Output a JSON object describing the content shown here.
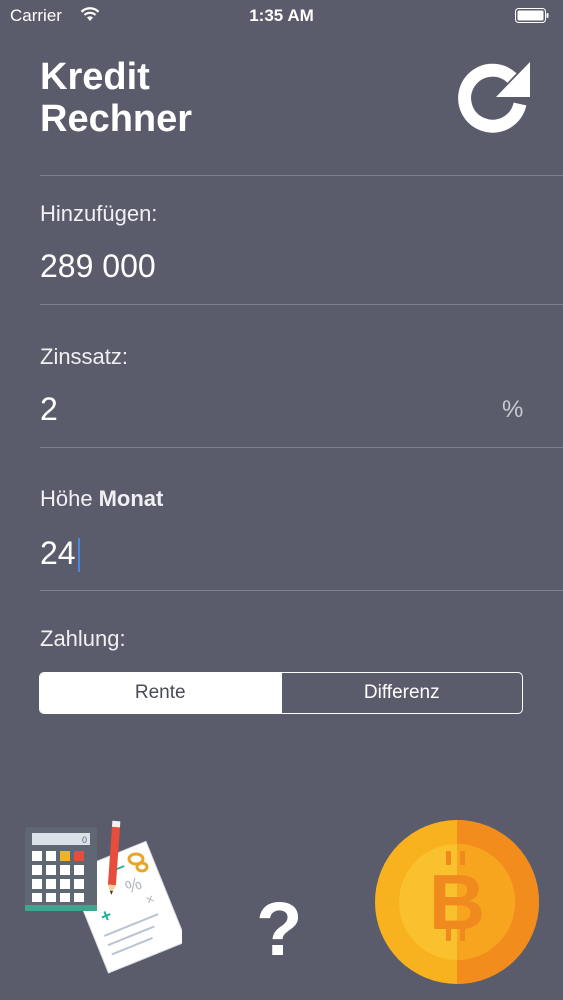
{
  "status_bar": {
    "carrier": "Carrier",
    "time": "1:35 AM"
  },
  "header": {
    "title_line1": "Kredit",
    "title_line2": "Rechner"
  },
  "fields": {
    "amount": {
      "label": "Hinzufügen:",
      "value": "289 000"
    },
    "interest": {
      "label": "Zinssatz:",
      "value": "2",
      "unit": "%"
    },
    "term": {
      "label": "Höhe",
      "label_bold": "Monat",
      "value": "24"
    }
  },
  "payment": {
    "label": "Zahlung:",
    "options": [
      "Rente",
      "Differenz"
    ],
    "selected": "Rente"
  },
  "bottom": {
    "help_symbol": "?"
  },
  "colors": {
    "background": "#5b5c6b",
    "accent_coin": "#f5a623",
    "caret": "#4b86e0"
  },
  "icons": [
    "wifi-icon",
    "battery-icon",
    "refresh-icon",
    "calculator-illustration",
    "bitcoin-coin-icon"
  ]
}
